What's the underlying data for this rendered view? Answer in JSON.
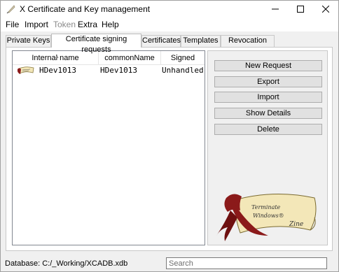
{
  "window": {
    "title": "X Certificate and Key management"
  },
  "menu": {
    "file": "File",
    "import": "Import",
    "token": "Token",
    "extra": "Extra",
    "help": "Help"
  },
  "tabs": [
    {
      "label": "Private Keys"
    },
    {
      "label": "Certificate signing requests",
      "active": true
    },
    {
      "label": "Certificates"
    },
    {
      "label": "Templates"
    },
    {
      "label": "Revocation lists"
    }
  ],
  "list": {
    "columns": [
      "Internal name",
      "commonName",
      "Signed"
    ],
    "rows": [
      {
        "internal_name": "HDev1013",
        "common_name": "HDev1013",
        "signed": "Unhandled"
      }
    ]
  },
  "actions": {
    "new_request": "New Request",
    "export": "Export",
    "import": "Import",
    "show_details": "Show Details",
    "delete": "Delete"
  },
  "artwork": {
    "line1": "Terminate",
    "line2": "Windows®",
    "line3": "Zine"
  },
  "status": {
    "database": "Database: C:/_Working/XCADB.xdb"
  },
  "search": {
    "placeholder": "Search",
    "value": ""
  },
  "colors": {
    "accent_red": "#8b1a1a",
    "parchment": "#f3e7b8"
  }
}
